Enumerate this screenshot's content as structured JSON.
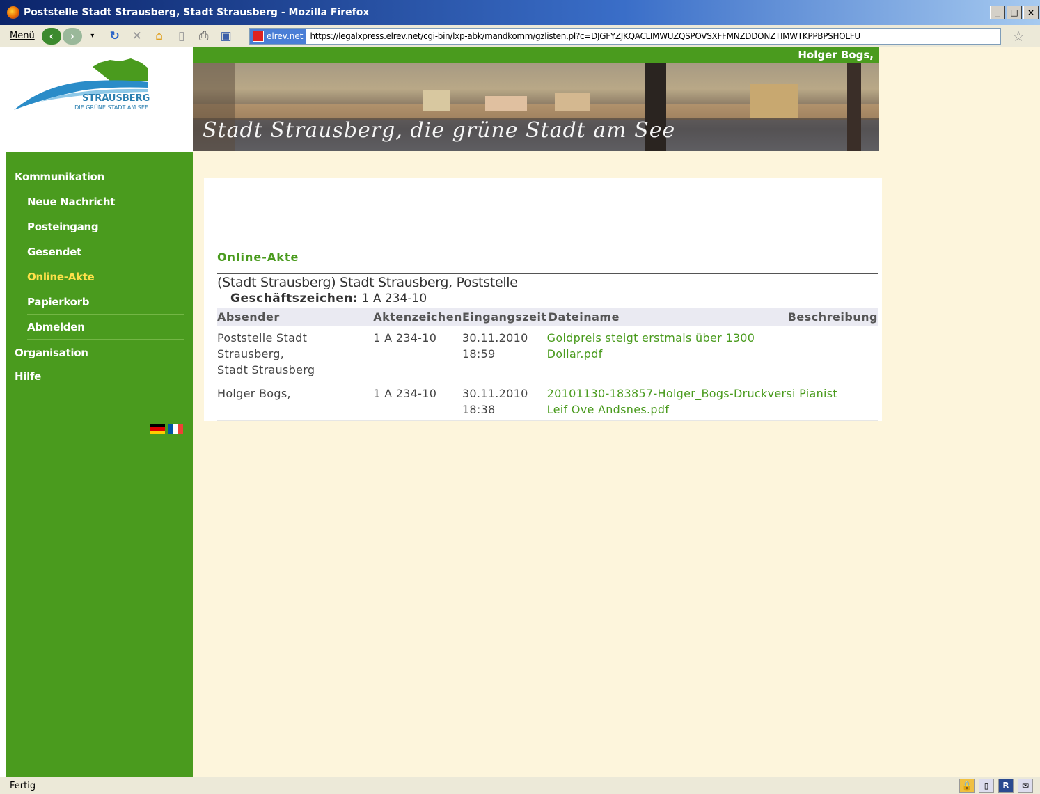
{
  "window": {
    "title": "Poststelle Stadt Strausberg, Stadt Strausberg - Mozilla Firefox"
  },
  "toolbar": {
    "menu_label": "Menü",
    "site_badge": "elrev.net",
    "url": "https://legalxpress.elrev.net/cgi-bin/lxp-abk/mandkomm/gzlisten.pl?c=DJGFYZJKQACLIMWUZQSPOVSXFFMNZDDONZTIMWTKPPBPSHOLFU"
  },
  "header": {
    "user": "Holger Bogs,",
    "logo_text": "STRAUSBERG",
    "logo_sub": "DIE GRÜNE STADT AM SEE",
    "banner_text": "Stadt Strausberg, die grüne Stadt am See"
  },
  "sidebar": {
    "kommunikation": "Kommunikation",
    "items": [
      {
        "label": "Neue Nachricht"
      },
      {
        "label": "Posteingang"
      },
      {
        "label": "Gesendet"
      },
      {
        "label": "Online-Akte"
      },
      {
        "label": "Papierkorb"
      },
      {
        "label": "Abmelden"
      }
    ],
    "organisation": "Organisation",
    "hilfe": "Hilfe"
  },
  "main": {
    "section_title": "Online-Akte",
    "org": "(Stadt Strausberg) Stadt Strausberg, Poststelle",
    "gz_label": "Geschäftszeichen:",
    "gz_value": "1 A 234-10",
    "columns": [
      "Absender",
      "Aktenzeichen",
      "Eingangszeit",
      "Dateiname",
      "Beschreibung"
    ],
    "rows": [
      {
        "sender_1": "Poststelle Stadt Strausberg,",
        "sender_2": "Stadt Strausberg",
        "az": "1 A 234-10",
        "date": "30.11.2010",
        "time": "18:59",
        "file_1": "Goldpreis steigt erstmals über 1300 Dollar.pdf",
        "file_2": "",
        "desc": ""
      },
      {
        "sender_1": "Holger Bogs,",
        "sender_2": "",
        "az": "1 A 234-10",
        "date": "30.11.2010",
        "time": "18:38",
        "file_1": "20101130-183857-Holger_Bogs-Druckversi Pianist",
        "file_2": "Leif Ove Andsnes.pdf",
        "desc": ""
      }
    ]
  },
  "statusbar": {
    "text": "Fertig"
  },
  "colors": {
    "green": "#4a9b1e",
    "cream": "#fdf5dc",
    "active": "#ffe14a"
  }
}
